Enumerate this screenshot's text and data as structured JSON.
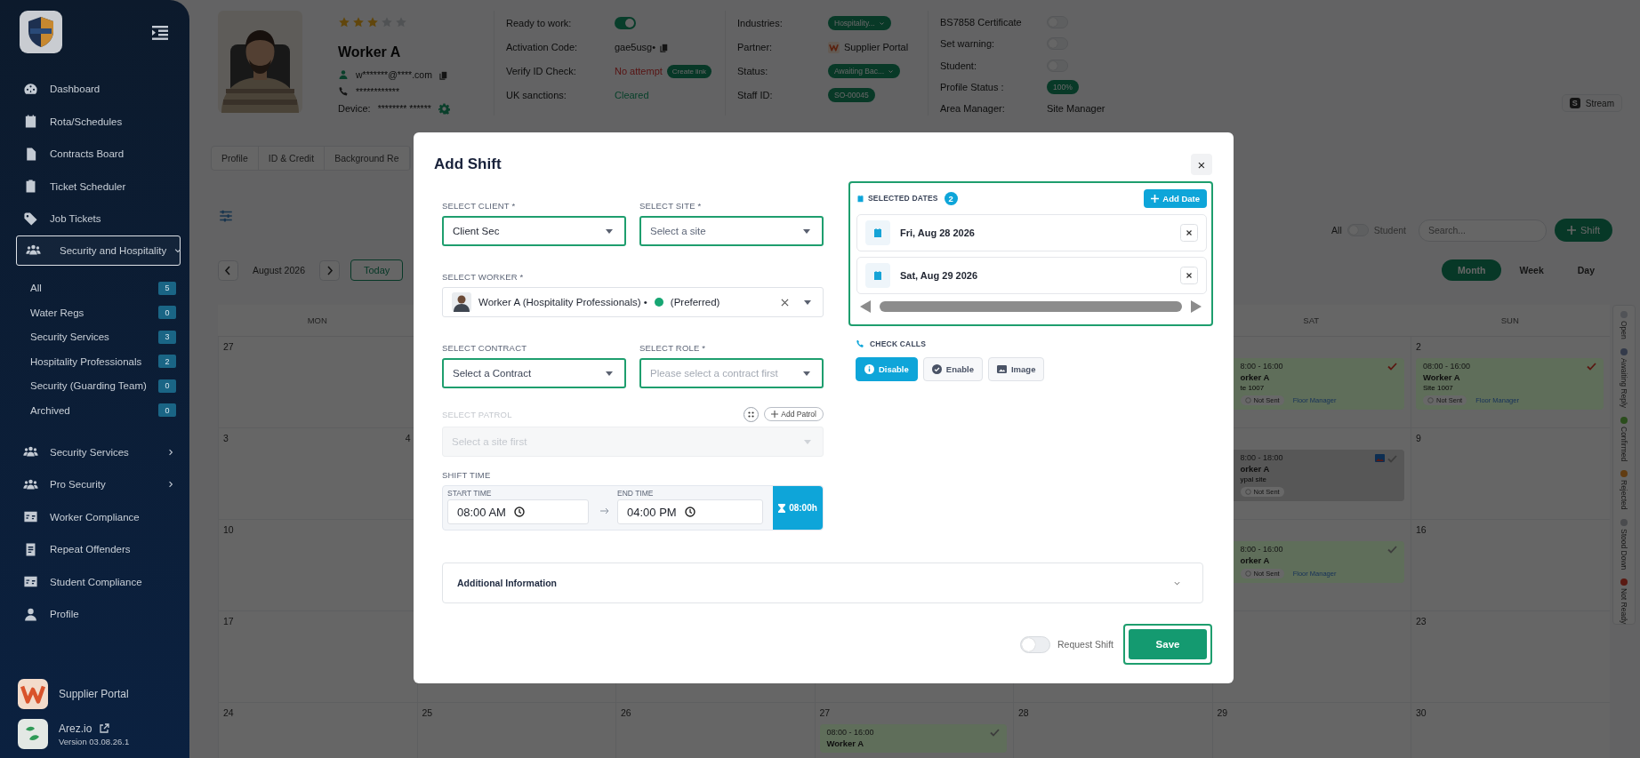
{
  "sidebar": {
    "nav_items": [
      {
        "label": "Dashboard",
        "selected": false
      },
      {
        "label": "Rota/Schedules",
        "selected": false
      },
      {
        "label": "Contracts Board",
        "selected": false
      },
      {
        "label": "Ticket Scheduler",
        "selected": false
      },
      {
        "label": "Job Tickets",
        "selected": false
      },
      {
        "label": "Security and Hospitality",
        "selected": true,
        "expanded": true,
        "children": [
          {
            "label": "All",
            "count": "5"
          },
          {
            "label": "Water Regs",
            "count": "0"
          },
          {
            "label": "Security Services",
            "count": "3"
          },
          {
            "label": "Hospitality Professionals",
            "count": "2"
          },
          {
            "label": "Security (Guarding Team)",
            "count": "0"
          },
          {
            "label": "Archived",
            "count": "0"
          }
        ]
      },
      {
        "label": "Security Services",
        "selected": false,
        "expanded": false
      },
      {
        "label": "Pro Security",
        "selected": false,
        "expanded": false
      },
      {
        "label": "Worker Compliance",
        "selected": false
      },
      {
        "label": "Repeat Offenders",
        "selected": false
      },
      {
        "label": "Student Compliance",
        "selected": false
      },
      {
        "label": "Profile",
        "selected": false
      }
    ],
    "footer_items": [
      {
        "label": "Supplier Portal"
      },
      {
        "label": "Arez.io",
        "version": "Version 03.08.26.1"
      }
    ]
  },
  "profile": {
    "stars": 3,
    "name": "Worker A",
    "email": "w*******@****.com",
    "phone": "************",
    "device_label": "Device:",
    "device_value": "******** ******"
  },
  "detail_columns": [
    {
      "fields": [
        {
          "label": "Ready to work:",
          "kind": "toggle",
          "on": true
        },
        {
          "label": "Activation Code:",
          "kind": "code",
          "value": "gae5usg•"
        },
        {
          "label": "Verify ID Check:",
          "kind": "alert",
          "value": "No attempt",
          "action": "Create link"
        },
        {
          "label": "UK sanctions:",
          "kind": "ok",
          "value": "Cleared"
        }
      ]
    },
    {
      "fields": [
        {
          "label": "Industries:",
          "kind": "pill",
          "value": "Hospitality...",
          "dropdown": true
        },
        {
          "label": "Partner:",
          "kind": "partner",
          "value": "Supplier Portal"
        },
        {
          "label": "Status:",
          "kind": "pill",
          "value": "Awaiting Bac...",
          "dropdown": true
        },
        {
          "label": "Staff ID:",
          "kind": "pill",
          "value": "SO-00045",
          "dropdown": false
        }
      ]
    },
    {
      "fields": [
        {
          "label": "BS7858 Certificate",
          "kind": "toggle",
          "on": false
        },
        {
          "label": "Set warning:",
          "kind": "toggle",
          "on": false
        },
        {
          "label": "Student:",
          "kind": "toggle",
          "on": false
        },
        {
          "label": "Profile Status :",
          "kind": "pill",
          "value": "100%",
          "dropdown": false
        },
        {
          "label": "Area Manager:",
          "kind": "plain",
          "value": "Site Manager"
        }
      ]
    }
  ],
  "stream_button": {
    "icon_letter": "S",
    "label": "Stream"
  },
  "tabs": [
    {
      "label": "Profile"
    },
    {
      "label": "ID & Credit"
    },
    {
      "label": "Background Re"
    }
  ],
  "toolbar": {
    "filter_toggle": {
      "left_label": "All",
      "on": false,
      "right_label": "Student"
    },
    "search": {
      "placeholder": "Search..."
    },
    "add_button": "Shift"
  },
  "calendar_nav": {
    "month": "August 2026",
    "today": "Today",
    "views": [
      {
        "label": "Month",
        "selected": true
      },
      {
        "label": "Week",
        "selected": false
      },
      {
        "label": "Day",
        "selected": false
      }
    ]
  },
  "calendar": {
    "weekdays": {
      "mon": "MON",
      "sat": "SAT",
      "sun": "SUN"
    },
    "weeks": [
      {
        "mon": {
          "day": "27"
        },
        "sat": {
          "event": {
            "time": "8:00 - 16:00",
            "worker": "orker A",
            "site": "te 1007",
            "status": "Not Sent",
            "role": "Floor Manager",
            "color": "#5f6e5a",
            "checked": true
          }
        },
        "sun": {
          "day": "2",
          "event": {
            "time": "08:00 - 16:00",
            "worker": "Worker A",
            "site": "Site 1007",
            "status": "Not Sent",
            "role": "Floor Manager",
            "color": "#5f6e5a",
            "checked": true
          }
        }
      },
      {
        "mon": {
          "day": "3",
          "extra": "4"
        },
        "sat": {
          "event": {
            "time": "8:00 - 18:00",
            "worker": "orker A",
            "site": "ypal site",
            "status": "Not Sent",
            "color": "#575757",
            "checked": false,
            "has_image": true
          }
        },
        "sun": {
          "day": "9"
        }
      },
      {
        "mon": {
          "day": "10"
        },
        "sat": {
          "event": {
            "time": "8:00 - 16:00",
            "worker": "orker A",
            "status": "Not Sent",
            "role": "Floor Manager",
            "color": "#5f6e5a",
            "checked": false
          }
        },
        "sun": {
          "day": "16"
        }
      },
      {
        "mon": {
          "day": "17"
        },
        "sun": {
          "day": "23"
        }
      },
      {
        "mon": {
          "day": "24"
        },
        "tue": {
          "day": "25"
        },
        "wed": {
          "day": "26"
        },
        "thu": {
          "day": "27",
          "event": {
            "time": "08:00 - 16:00",
            "worker": "Worker A",
            "color": "#5f6e5a",
            "checked": false
          }
        },
        "fri": {
          "day": "28"
        },
        "sat": {
          "day": "29"
        },
        "sun": {
          "day": "30"
        }
      }
    ]
  },
  "legend": [
    {
      "label": "Open",
      "color": "#515357"
    },
    {
      "label": "Awaiting Reply",
      "color": "#333a4a"
    },
    {
      "label": "Confirmed",
      "color": "#2b4d1d"
    },
    {
      "label": "Rejected",
      "color": "#613c12"
    },
    {
      "label": "Stood Down",
      "color": "#4a4b4e"
    },
    {
      "label": "Not Ready",
      "color": "#5a1a13"
    }
  ],
  "modal": {
    "title": "Add Shift",
    "close": "×",
    "client": {
      "label": "SELECT CLIENT *",
      "value": "Client Sec",
      "highlighted": true
    },
    "site": {
      "label": "SELECT SITE *",
      "placeholder": "Select a site",
      "highlighted": true
    },
    "worker": {
      "label": "SELECT WORKER *",
      "value": "Worker A (Hospitality Professionals) •",
      "tag": "(Preferred)",
      "highlighted": false
    },
    "contract": {
      "label": "SELECT CONTRACT",
      "placeholder": "Select a Contract",
      "highlighted": true
    },
    "role": {
      "label": "SELECT ROLE *",
      "placeholder": "Please select a contract first",
      "highlighted": true
    },
    "patrol": {
      "label": "SELECT PATROL",
      "placeholder": "Select a site first",
      "disabled": true,
      "add_button": "Add Patrol"
    },
    "shift_time": {
      "label": "SHIFT TIME",
      "start_label": "START TIME",
      "start": "08:00 AM",
      "end_label": "END TIME",
      "end": "04:00 PM",
      "duration": "08:00h"
    },
    "additional_info": {
      "label": "Additional Information",
      "expanded": false
    },
    "selected_dates": {
      "label": "SELECTED DATES",
      "count": "2",
      "add_button": "Add Date",
      "dates": [
        "Fri, Aug 28 2026",
        "Sat, Aug 29 2026"
      ]
    },
    "check_calls": {
      "label": "CHECK CALLS",
      "options": [
        {
          "label": "Disable",
          "selected": true
        },
        {
          "label": "Enable",
          "selected": false
        },
        {
          "label": "Image",
          "selected": false
        }
      ]
    },
    "request_shift": {
      "label": "Request Shift",
      "on": false
    },
    "save": "Save"
  }
}
